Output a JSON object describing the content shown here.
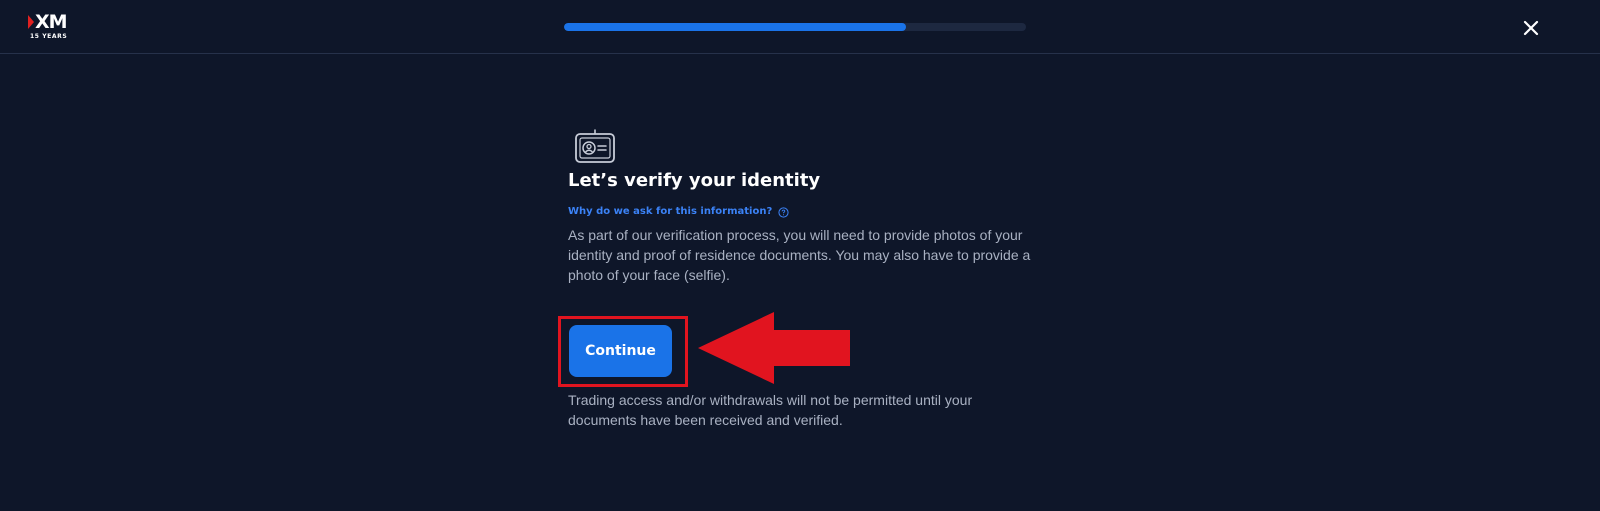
{
  "header": {
    "logo_text": "XM",
    "logo_subtext": "15 YEARS",
    "progress": 0.74,
    "close_icon": "close-icon"
  },
  "main": {
    "icon": "id-card-icon",
    "title": "Let’s verify your identity",
    "why_link": "Why do we ask for this information?",
    "why_icon": "help-circle-icon",
    "description": "As part of our verification process, you will need to provide photos of your identity and proof of residence documents. You may also have to provide a photo of your face (selfie).",
    "continue_label": "Continue",
    "note": "Trading access and/or withdrawals will not be permitted until your documents have been received and verified."
  },
  "colors": {
    "background": "#0e1629",
    "accent": "#1a73e8",
    "link": "#3b82f6",
    "annotation_red": "#e1141f"
  }
}
